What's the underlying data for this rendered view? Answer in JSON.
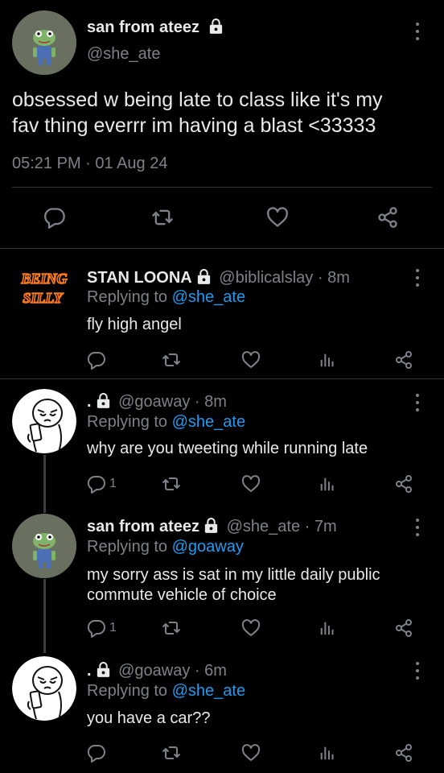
{
  "main_tweet": {
    "display_name": "san from ateez",
    "handle": "@she_ate",
    "text_line1": "obsessed w being late to class like it's my",
    "text_line2": "fav thing everrr im having a blast <33333",
    "timestamp": "05:21 PM · 01 Aug 24"
  },
  "replies": [
    {
      "display_name": "STAN LOONA",
      "meta": "@biblicalslay · 8m",
      "replying_prefix": "Replying to",
      "replying_to": "@she_ate",
      "text": "fly high angel",
      "reply_count": "",
      "avatar_text_line1": "BEING",
      "avatar_text_line2": "SILLY"
    },
    {
      "display_name": ".",
      "meta": "@goaway · 8m",
      "replying_prefix": "Replying to",
      "replying_to": "@she_ate",
      "text": "why are you tweeting while running late",
      "reply_count": "1"
    },
    {
      "display_name": "san from ateez",
      "meta": "@she_ate · 7m",
      "replying_prefix": "Replying to",
      "replying_to": "@goaway",
      "text_line1": "my sorry ass is sat in my little daily public",
      "text_line2": "commute vehicle of choice",
      "reply_count": "1"
    },
    {
      "display_name": ".",
      "meta": "@goaway · 6m",
      "replying_prefix": "Replying to",
      "replying_to": "@she_ate",
      "text": "you have a car??",
      "reply_count": ""
    }
  ],
  "colors": {
    "background": "#000000",
    "text": "#e7e9ea",
    "secondary": "#7d8288",
    "link": "#1d9bf0",
    "divider": "#2f3336"
  },
  "icons": [
    "lock-icon",
    "reply-icon",
    "retweet-icon",
    "like-icon",
    "views-icon",
    "share-icon",
    "more-icon"
  ]
}
